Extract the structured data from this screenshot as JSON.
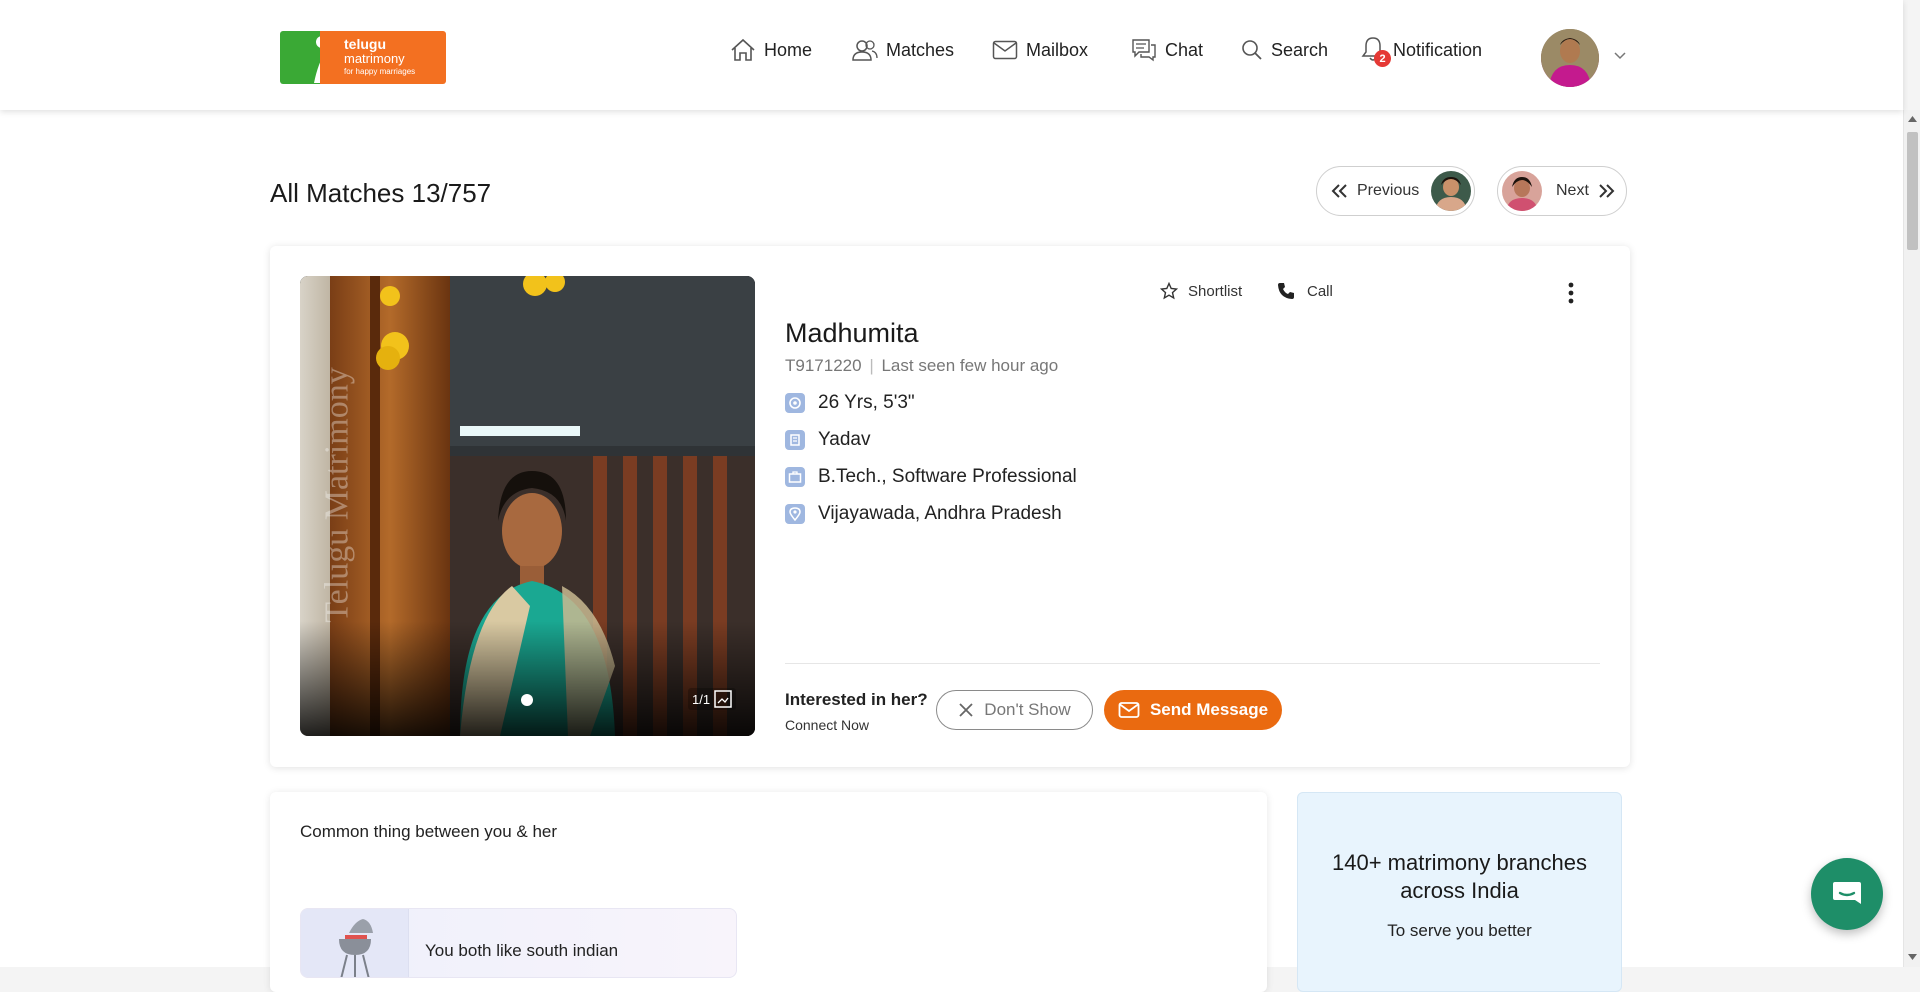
{
  "brand": {
    "line1": "telugu",
    "line2": "matrimony",
    "tagline": "for happy marriages"
  },
  "nav": {
    "home": "Home",
    "matches": "Matches",
    "mailbox": "Mailbox",
    "chat": "Chat",
    "search": "Search",
    "notification": "Notification",
    "notification_count": "2"
  },
  "page": {
    "title": "All Matches 13/757",
    "previous": "Previous",
    "next": "Next"
  },
  "profile": {
    "name": "Madhumita",
    "id": "T9171220",
    "separator": "|",
    "last_seen": "Last seen few hour ago",
    "age_height": "26 Yrs, 5'3\"",
    "caste": "Yadav",
    "education": "B.Tech., Software Professional",
    "location": "Vijayawada, Andhra Pradesh",
    "photo_counter": "1/1",
    "watermark": "Telugu Matrimony"
  },
  "actions": {
    "shortlist": "Shortlist",
    "call": "Call",
    "interest_question": "Interested in her?",
    "connect_now": "Connect Now",
    "dont_show": "Don't Show",
    "send_message": "Send Message"
  },
  "common": {
    "title": "Common thing between you & her",
    "item": "You both like south indian"
  },
  "branches": {
    "heading": "140+ matrimony branches across India",
    "sub": "To serve you better"
  },
  "colors": {
    "accent": "#ea6a10",
    "brand_green": "#3aa935",
    "brand_orange": "#f37021",
    "chat_fab": "#1e8e68"
  }
}
